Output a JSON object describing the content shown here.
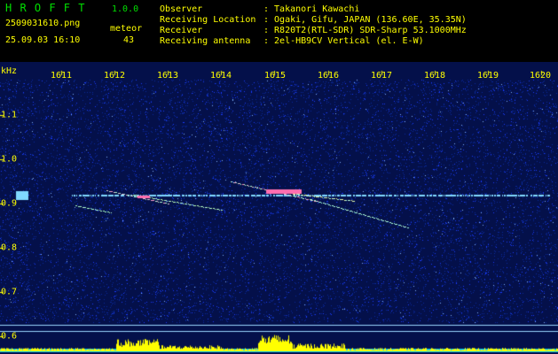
{
  "header": {
    "app_name": "H R O F F T",
    "version": "1.0.0",
    "filename": "2509031610.png",
    "datetime": "25.09.03 16:10",
    "meteor_label": "meteor",
    "meteor_count": "43"
  },
  "info": {
    "labels": [
      "Observer",
      "Receiving Location",
      "Receiver",
      "Receiving antenna"
    ],
    "values": [
      ": Takanori Kawachi",
      ": Ogaki, Gifu, JAPAN (136.60E, 35.35N)",
      ": R820T2(RTL-SDR) SDR-Sharp 53.1000MHz",
      ": 2el-HB9CV Vertical (el. E-W)"
    ]
  },
  "spectrogram": {
    "unit_label": "kHz",
    "x_ticks": [
      "1611",
      "1612",
      "1613",
      "1614",
      "1615",
      "1616",
      "1617",
      "1618",
      "1619",
      "1620"
    ],
    "y_ticks": [
      "1.1",
      "1.0",
      "0.9",
      "0.8",
      "0.7",
      "0.6"
    ],
    "colors": {
      "background": "#04104a",
      "noise": "#1a3cff",
      "carrier": "#7fd8ff",
      "echo": "#ff6fb0",
      "level_fill": "#ffff00",
      "level_base": "#00c8ff",
      "labels": "#ffff00"
    }
  }
}
